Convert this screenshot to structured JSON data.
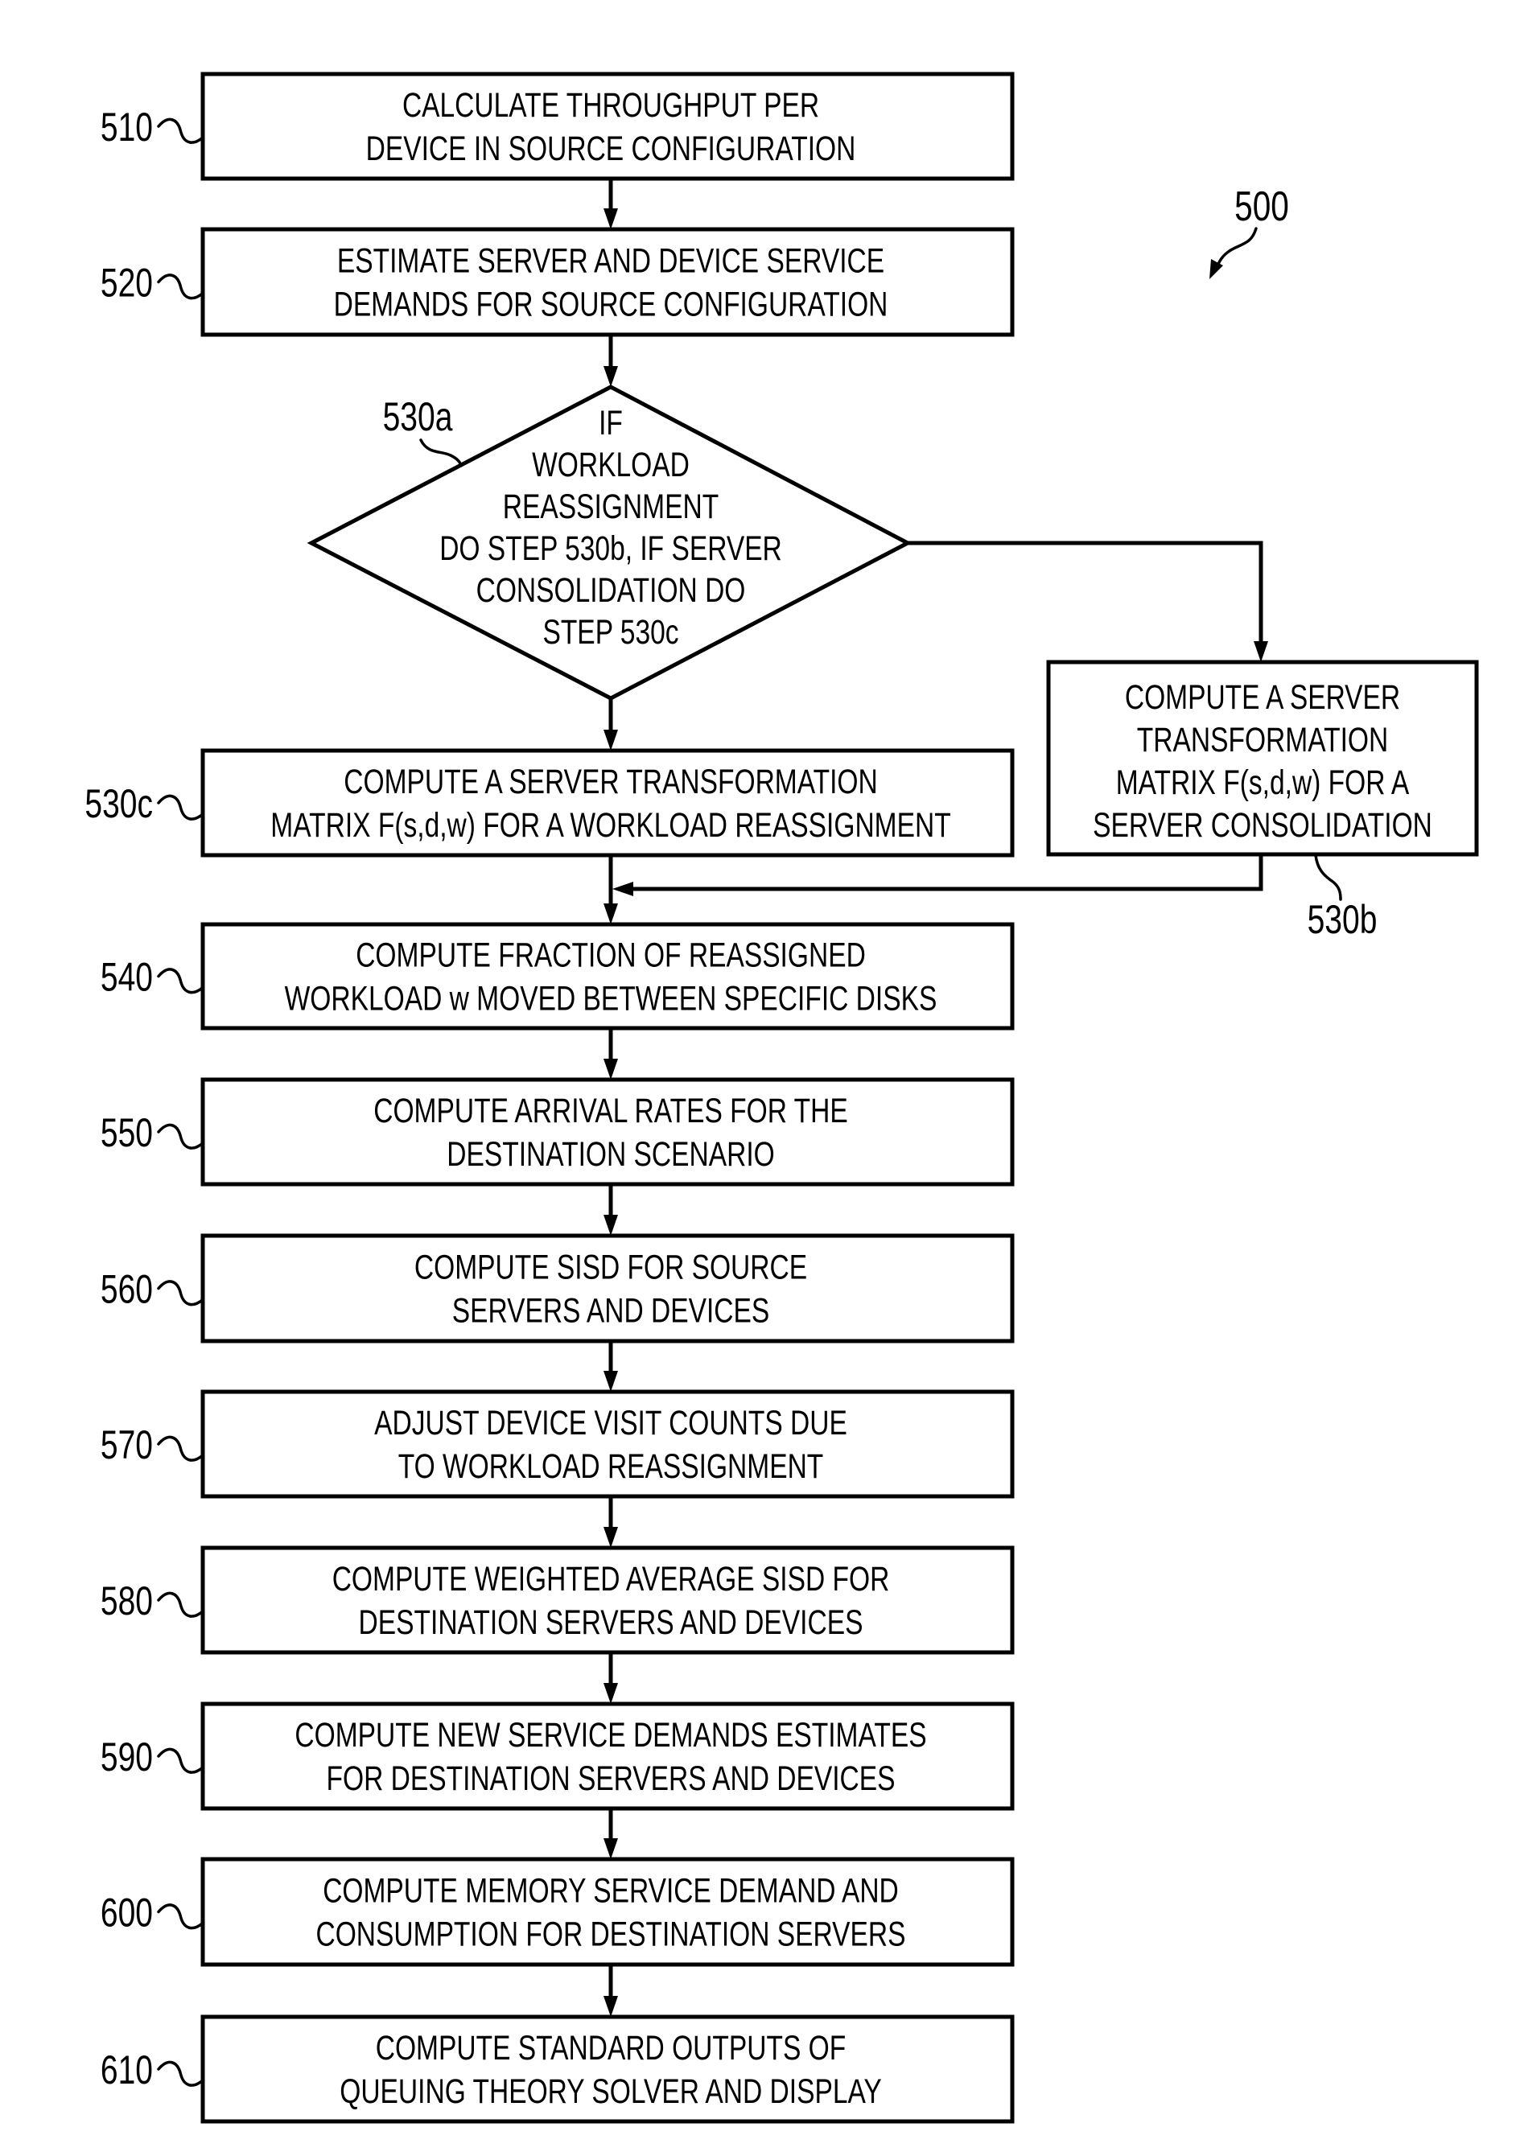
{
  "figure": {
    "reference": "500"
  },
  "steps": [
    {
      "id": "510",
      "label": "510",
      "lines": [
        "CALCULATE THROUGHPUT PER",
        "DEVICE IN SOURCE CONFIGURATION"
      ]
    },
    {
      "id": "520",
      "label": "520",
      "lines": [
        "ESTIMATE SERVER AND DEVICE SERVICE",
        "DEMANDS FOR SOURCE CONFIGURATION"
      ]
    },
    {
      "id": "530c",
      "label": "530c",
      "lines": [
        "COMPUTE A SERVER TRANSFORMATION",
        "MATRIX F(s,d,w) FOR A WORKLOAD REASSIGNMENT"
      ]
    },
    {
      "id": "540",
      "label": "540",
      "lines": [
        "COMPUTE FRACTION OF REASSIGNED",
        "WORKLOAD w MOVED BETWEEN SPECIFIC DISKS"
      ]
    },
    {
      "id": "550",
      "label": "550",
      "lines": [
        "COMPUTE ARRIVAL RATES FOR THE",
        "DESTINATION SCENARIO"
      ]
    },
    {
      "id": "560",
      "label": "560",
      "lines": [
        "COMPUTE SISD FOR SOURCE",
        "SERVERS AND DEVICES"
      ]
    },
    {
      "id": "570",
      "label": "570",
      "lines": [
        "ADJUST DEVICE VISIT COUNTS DUE",
        "TO WORKLOAD REASSIGNMENT"
      ]
    },
    {
      "id": "580",
      "label": "580",
      "lines": [
        "COMPUTE WEIGHTED AVERAGE SISD FOR",
        "DESTINATION SERVERS AND DEVICES"
      ]
    },
    {
      "id": "590",
      "label": "590",
      "lines": [
        "COMPUTE NEW SERVICE DEMANDS ESTIMATES",
        "FOR DESTINATION SERVERS AND DEVICES"
      ]
    },
    {
      "id": "600",
      "label": "600",
      "lines": [
        "COMPUTE MEMORY SERVICE DEMAND AND",
        "CONSUMPTION FOR DESTINATION SERVERS"
      ]
    },
    {
      "id": "610",
      "label": "610",
      "lines": [
        "COMPUTE STANDARD OUTPUTS OF",
        "QUEUING THEORY SOLVER AND DISPLAY"
      ]
    }
  ],
  "decision": {
    "id": "530a",
    "label": "530a",
    "lines": [
      "IF",
      "WORKLOAD",
      "REASSIGNMENT",
      "DO STEP 530b, IF SERVER",
      "CONSOLIDATION DO",
      "STEP 530c"
    ]
  },
  "side_step": {
    "id": "530b",
    "label": "530b",
    "lines": [
      "COMPUTE A SERVER",
      "TRANSFORMATION",
      "MATRIX F(s,d,w) FOR A",
      "SERVER CONSOLIDATION"
    ]
  }
}
